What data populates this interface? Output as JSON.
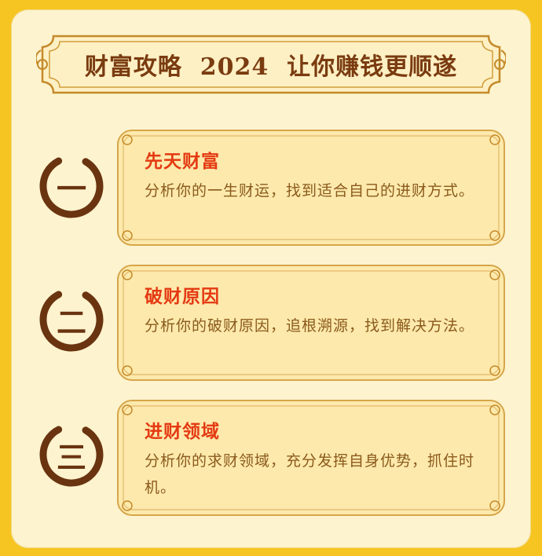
{
  "header": {
    "title": "财富攻略  2024  让你赚钱更顺遂"
  },
  "sections": [
    {
      "numeral": "一",
      "title": "先天财富",
      "description": "分析你的一生财运，找到适合自己的进财方式。"
    },
    {
      "numeral": "二",
      "title": "破财原因",
      "description": "分析你的破财原因，追根溯源，找到解决方法。"
    },
    {
      "numeral": "三",
      "title": "进财领域",
      "description": "分析你的求财领域，充分发挥自身优势，抓住时机。"
    }
  ],
  "colors": {
    "background": "#f7c521",
    "panel": "#fdf3cf",
    "title": "#7a3b10",
    "accent": "#e43a12",
    "text": "#8a5a1c"
  }
}
